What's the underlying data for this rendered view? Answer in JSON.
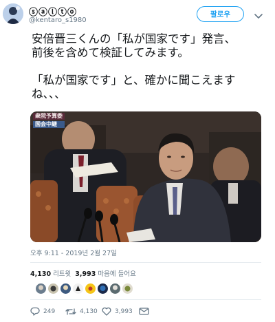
{
  "user": {
    "display_name": "ⓢⓐⓛⓣⓞ",
    "handle": "@kentaro_s1980"
  },
  "follow_label": "팔로우",
  "tweet_text": "安倍晋三くんの「私が国家です」発言、\n前後を含めて検証してみます。\n\n「私が国家です」と、確かに聞こえます\nね、、、",
  "media": {
    "caption_line1": "衆院予算委",
    "caption_line2": "国会中継"
  },
  "timestamp": "오후 9:11 - 2019년 2월 27일",
  "stats": {
    "retweets_count": "4,130",
    "retweets_label": "리트윗",
    "likes_count": "3,993",
    "likes_label": "마음에 들어요"
  },
  "actions": {
    "reply_count": "249",
    "retweet_count": "4,130",
    "like_count": "3,993"
  },
  "icons": {
    "reply": "reply-icon",
    "retweet": "retweet-icon",
    "like": "heart-icon",
    "dm": "envelope-icon",
    "caret": "chevron-down-icon"
  },
  "colors": {
    "accent": "#1da1f2",
    "text": "#14171a",
    "secondary": "#657786"
  }
}
